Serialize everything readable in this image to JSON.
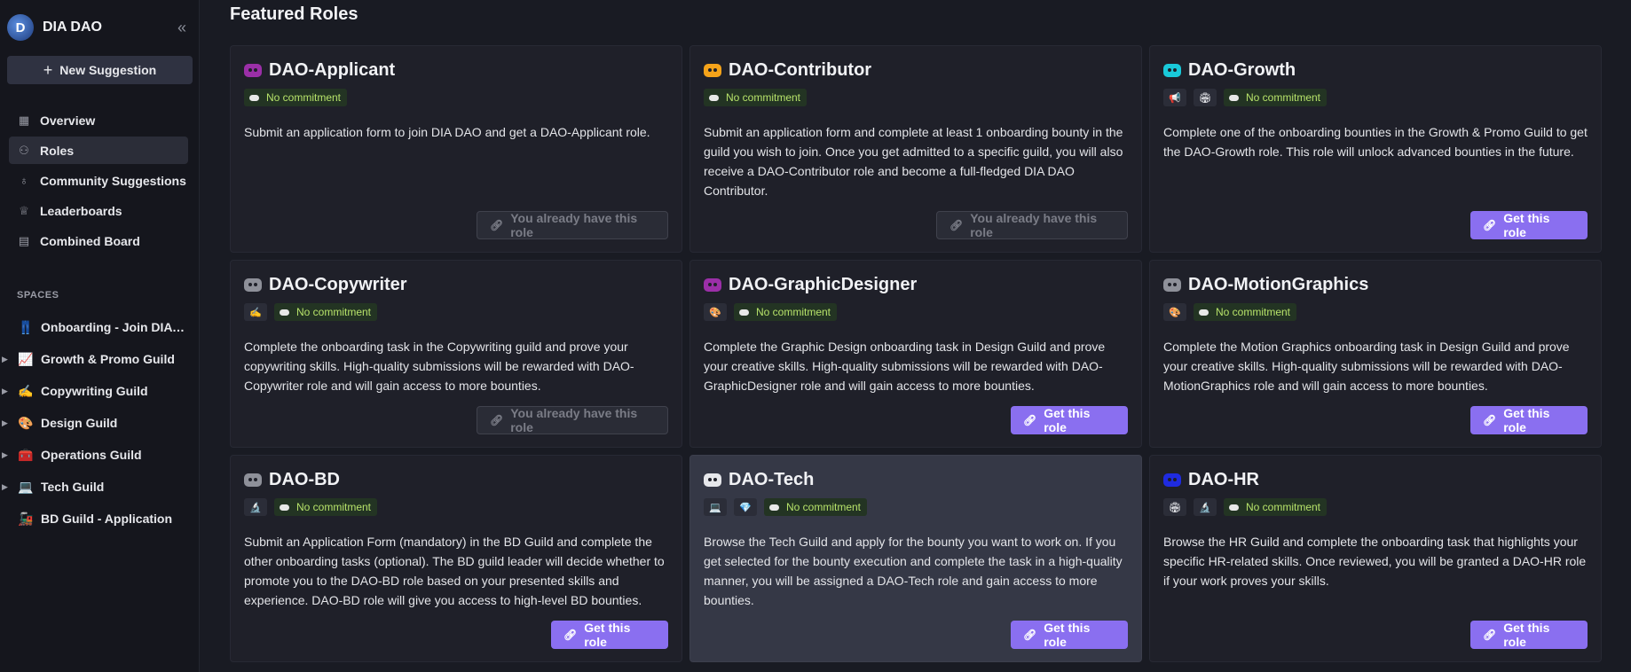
{
  "sidebar": {
    "title": "DIA DAO",
    "new_suggestion": "New Suggestion",
    "nav": [
      {
        "label": "Overview",
        "icon": "grid-icon"
      },
      {
        "label": "Roles",
        "icon": "users-icon"
      },
      {
        "label": "Community Suggestions",
        "icon": "lightbulb-icon"
      },
      {
        "label": "Leaderboards",
        "icon": "trophy-icon"
      },
      {
        "label": "Combined Board",
        "icon": "board-icon"
      }
    ],
    "spaces_label": "SPACES",
    "spaces": [
      {
        "label": "Onboarding - Join DIA DAO",
        "emoji": "👖"
      },
      {
        "label": "Growth & Promo Guild",
        "emoji": "📈"
      },
      {
        "label": "Copywriting Guild",
        "emoji": "✍️"
      },
      {
        "label": "Design Guild",
        "emoji": "🎨"
      },
      {
        "label": "Operations Guild",
        "emoji": "🧰"
      },
      {
        "label": "Tech Guild",
        "emoji": "💻"
      },
      {
        "label": "BD Guild - Application",
        "emoji": "🚂"
      }
    ]
  },
  "main": {
    "title": "Featured Roles",
    "cards": [
      {
        "title": "DAO-Applicant",
        "icon_color": "#9b2fa8",
        "emojis": [],
        "commitment": "No commitment",
        "desc": "Submit an application form to join DIA DAO and get a DAO-Applicant role.",
        "button": "You already have this role",
        "owned": true
      },
      {
        "title": "DAO-Contributor",
        "icon_color": "#f5a31a",
        "emojis": [],
        "commitment": "No commitment",
        "desc": "Submit an application form and complete at least 1 onboarding bounty in the guild you wish to join. Once you get admitted to a specific guild, you will also receive a DAO-Contributor role and become a full-fledged DIA DAO Contributor.",
        "button": "You already have this role",
        "owned": true
      },
      {
        "title": "DAO-Growth",
        "icon_color": "#19c9d9",
        "emojis": [
          "📢",
          "🏟"
        ],
        "commitment": "No commitment",
        "desc": "Complete one of the onboarding bounties in the Growth & Promo Guild to get the DAO-Growth role. This role will unlock advanced bounties in the future.",
        "button": "Get this role",
        "owned": false
      },
      {
        "title": "DAO-Copywriter",
        "icon_color": "#8e9099",
        "emojis": [
          "✍️"
        ],
        "commitment": "No commitment",
        "desc": "Complete the onboarding task in the Copywriting guild and prove your copywriting skills. High-quality submissions will be rewarded with DAO-Copywriter role and will gain access to more bounties.",
        "button": "You already have this role",
        "owned": true
      },
      {
        "title": "DAO-GraphicDesigner",
        "icon_color": "#9b2fa8",
        "emojis": [
          "🎨"
        ],
        "commitment": "No commitment",
        "desc": "Complete the Graphic Design onboarding task in Design Guild and prove your creative skills. High-quality submissions will be rewarded with DAO-GraphicDesigner role and will gain access to more bounties.",
        "button": "Get this role",
        "owned": false
      },
      {
        "title": "DAO-MotionGraphics",
        "icon_color": "#8e9099",
        "emojis": [
          "🎨"
        ],
        "commitment": "No commitment",
        "desc": "Complete the Motion Graphics onboarding task in Design Guild and prove your creative skills. High-quality submissions will be rewarded with DAO-MotionGraphics role and will gain access to more bounties.",
        "button": "Get this role",
        "owned": false
      },
      {
        "title": "DAO-BD",
        "icon_color": "#8e9099",
        "emojis": [
          "🔬"
        ],
        "commitment": "No commitment",
        "desc": "Submit an Application Form (mandatory) in the BD Guild and complete the other onboarding tasks (optional). The BD guild leader will decide whether to promote you to the DAO-BD role based on your presented skills and experience. DAO-BD role will give you access to high-level BD bounties.",
        "button": "Get this role",
        "owned": false
      },
      {
        "title": "DAO-Tech",
        "icon_color": "#e6e7eb",
        "emojis": [
          "💻",
          "💎"
        ],
        "commitment": "No commitment",
        "desc": "Browse the Tech Guild and apply for the bounty you want to work on. If you get selected for the bounty execution and complete the task in a high-quality manner, you will be assigned a DAO-Tech role and gain access to more bounties.",
        "button": "Get this role",
        "owned": false
      },
      {
        "title": "DAO-HR",
        "icon_color": "#1f2be0",
        "emojis": [
          "🏟",
          "🔬"
        ],
        "commitment": "No commitment",
        "desc": "Browse the HR Guild and complete the onboarding task that highlights your specific HR-related skills. Once reviewed, you will be granted a DAO-HR role if your work proves your skills.",
        "button": "Get this role",
        "owned": false
      }
    ]
  }
}
